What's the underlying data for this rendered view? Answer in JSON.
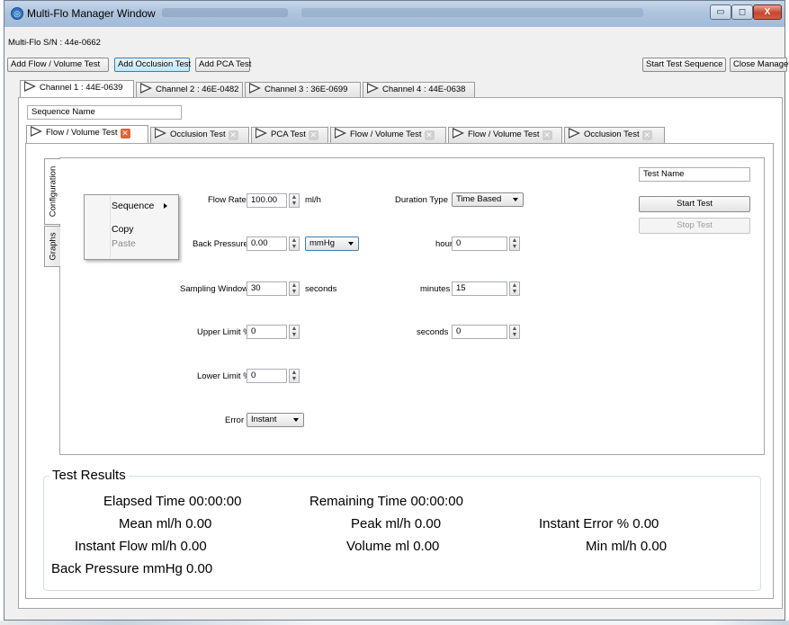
{
  "window": {
    "title": "Multi-Flo Manager Window",
    "icon": "app-icon",
    "controls": {
      "minimize": "▭",
      "maximize": "◻",
      "close": "X"
    }
  },
  "serial": "Multi-Flo S/N : 44e-0662",
  "toolbar": {
    "add_flow": "Add Flow / Volume Test",
    "add_occlusion": "Add Occlusion Test",
    "add_pca": "Add PCA Test",
    "start_sequence": "Start Test Sequence",
    "close_manager": "Close Manager"
  },
  "channels": [
    {
      "label": "Channel 1 : 44E-0639"
    },
    {
      "label": "Channel 2 : 46E-0482"
    },
    {
      "label": "Channel 3 : 36E-0699"
    },
    {
      "label": "Channel 4 : 44E-0638"
    }
  ],
  "sequence_name": {
    "placeholder": "Sequence Name"
  },
  "tests": [
    {
      "label": "Flow / Volume Test"
    },
    {
      "label": "Occlusion Test"
    },
    {
      "label": "PCA Test"
    },
    {
      "label": "Flow / Volume Test"
    },
    {
      "label": "Flow / Volume Test"
    },
    {
      "label": "Occlusion Test"
    }
  ],
  "side_tabs": {
    "configuration": "Configuration",
    "graphs": "Graphs"
  },
  "context_menu": {
    "sequence": "Sequence",
    "copy": "Copy",
    "paste": "Paste"
  },
  "form": {
    "flow_rate": {
      "label": "Flow Rate",
      "value": "100.00",
      "unit": "ml/h"
    },
    "back_pressure": {
      "label": "Back Pressure",
      "value": "0.00",
      "unit": "mmHg"
    },
    "sampling_window": {
      "label": "Sampling Window",
      "value": "30",
      "unit": "seconds"
    },
    "upper_limit": {
      "label": "Upper Limit %",
      "value": "0"
    },
    "lower_limit": {
      "label": "Lower Limit %",
      "value": "0"
    },
    "error": {
      "label": "Error",
      "value": "Instant"
    },
    "duration_type": {
      "label": "Duration Type",
      "value": "Time Based"
    },
    "hours": {
      "label": "hours",
      "value": "0"
    },
    "minutes": {
      "label": "minutes",
      "value": "15"
    },
    "seconds": {
      "label": "seconds",
      "value": "0"
    }
  },
  "test_name": {
    "placeholder": "Test Name"
  },
  "start_test": "Start Test",
  "stop_test": "Stop Test",
  "results": {
    "title": "Test Results",
    "elapsed": "Elapsed Time 00:00:00",
    "remaining": "Remaining Time 00:00:00",
    "mean": "Mean ml/h 0.00",
    "peak": "Peak ml/h 0.00",
    "instant_error": "Instant Error % 0.00",
    "instant_flow": "Instant Flow ml/h 0.00",
    "volume": "Volume ml 0.00",
    "min": "Min ml/h 0.00",
    "back_pressure": "Back Pressure mmHg 0.00"
  },
  "colors": {
    "accent": "#3c7fb1",
    "close_active": "#e0632f",
    "titlebar": "#aec4dd"
  }
}
